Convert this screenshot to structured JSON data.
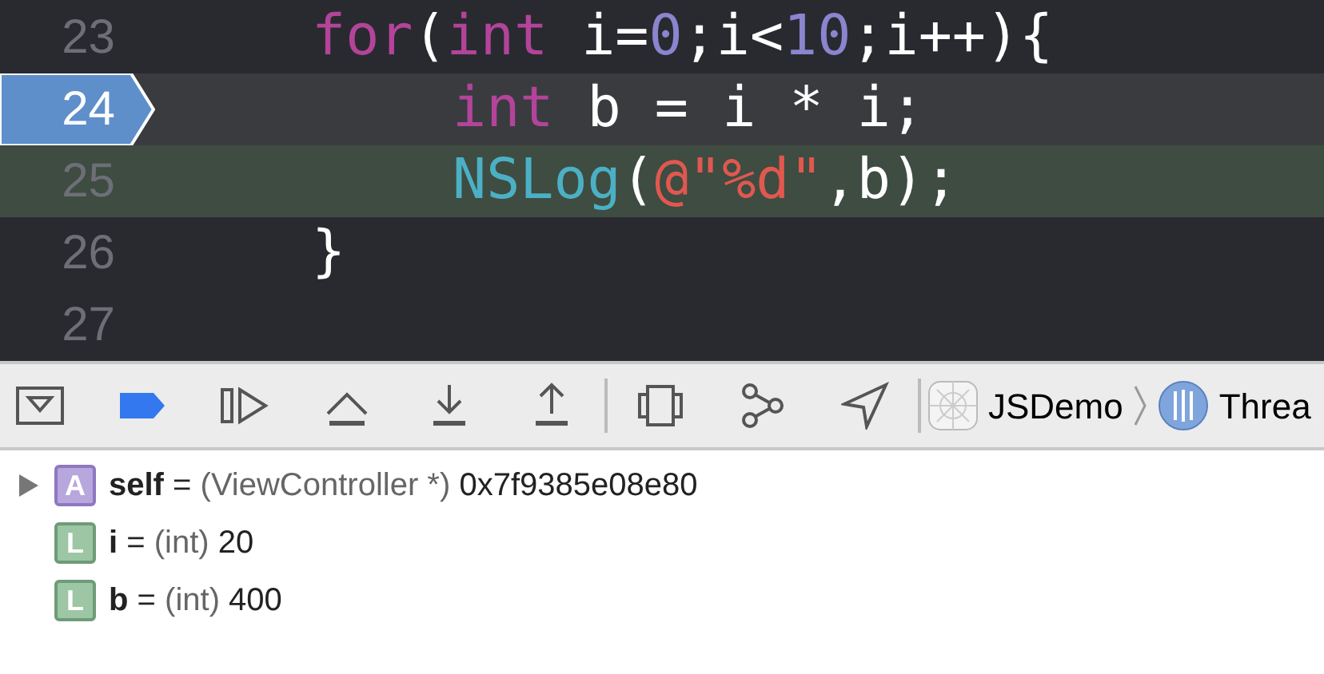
{
  "editor": {
    "lines": [
      {
        "number": "23",
        "current": false,
        "highlighted": false,
        "tokens": [
          {
            "kind": "keyword",
            "text": "for"
          },
          {
            "kind": "plain",
            "text": "("
          },
          {
            "kind": "keyword",
            "text": "int"
          },
          {
            "kind": "plain",
            "text": " i="
          },
          {
            "kind": "number",
            "text": "0"
          },
          {
            "kind": "plain",
            "text": ";i<"
          },
          {
            "kind": "number",
            "text": "10"
          },
          {
            "kind": "plain",
            "text": ";i++){"
          }
        ],
        "children": [
          {
            "number": "24",
            "current": true,
            "highlighted": false,
            "tokens": [
              {
                "kind": "keyword",
                "text": "int"
              },
              {
                "kind": "plain",
                "text": " b = i * i;"
              }
            ]
          },
          {
            "number": "25",
            "current": false,
            "highlighted": true,
            "tokens": [
              {
                "kind": "function",
                "text": "NSLog"
              },
              {
                "kind": "plain",
                "text": "("
              },
              {
                "kind": "string",
                "text": "@\"%d\""
              },
              {
                "kind": "plain",
                "text": ",b);"
              }
            ]
          }
        ]
      },
      {
        "number": "26",
        "current": false,
        "highlighted": false,
        "tokens": [
          {
            "kind": "plain",
            "text": "}"
          }
        ]
      },
      {
        "number": "27",
        "current": false,
        "highlighted": false
      }
    ]
  },
  "debug_bar": {
    "breakpoints_active": true,
    "breadcrumbs": [
      {
        "kind": "app",
        "text": "JSDemo"
      },
      {
        "kind": "thread",
        "text": "Threa"
      }
    ]
  },
  "variables": [
    {
      "kind": "argument",
      "badge": "A",
      "expandable": true,
      "name": "self",
      "separator": "=",
      "type": "(ViewController *)",
      "value": "0x7f9385e08e80"
    },
    {
      "kind": "local",
      "badge": "L",
      "expandable": false,
      "name": "i",
      "separator": "=",
      "type": "(int)",
      "value": "20"
    },
    {
      "kind": "local",
      "badge": "L",
      "expandable": false,
      "name": "b",
      "separator": "=",
      "type": "(int)",
      "value": "400"
    }
  ]
}
